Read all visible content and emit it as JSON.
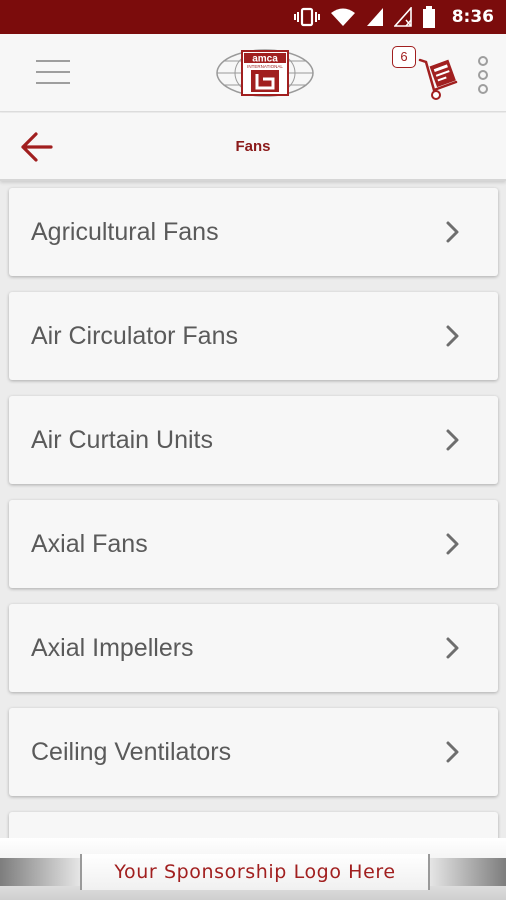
{
  "status_bar": {
    "time": "8:36",
    "icons": [
      "vibrate-icon",
      "wifi-icon",
      "signal-icon",
      "signal-empty-icon",
      "battery-icon"
    ],
    "background": "#7b0c0c"
  },
  "app_bar": {
    "menu_icon": "hamburger-menu-icon",
    "logo": {
      "text": "amca",
      "subtext": "INTERNATIONAL"
    },
    "cart_count": "6",
    "cart_icon": "hand-truck-cart-icon",
    "overflow_icon": "more-vert-icon"
  },
  "toolbar": {
    "back_icon": "arrow-back-icon",
    "title": "Fans"
  },
  "list": {
    "items": [
      {
        "label": "Agricultural Fans"
      },
      {
        "label": "Air Circulator Fans"
      },
      {
        "label": "Air Curtain Units"
      },
      {
        "label": "Axial Fans"
      },
      {
        "label": "Axial Impellers"
      },
      {
        "label": "Ceiling Ventilators"
      }
    ],
    "chevron_icon": "chevron-right-icon"
  },
  "footer": {
    "sponsor_text": "Your Sponsorship Logo Here"
  },
  "colors": {
    "brand": "#8b1a1a",
    "status_bar": "#7b0c0c",
    "item_text": "#5a5a5a",
    "background": "#ececec"
  }
}
